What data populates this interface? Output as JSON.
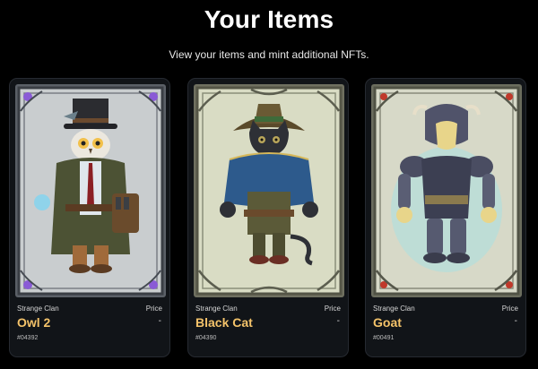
{
  "header": {
    "title": "Your Items",
    "subtitle": "View your items and mint additional NFTs."
  },
  "items": [
    {
      "clan": "Strange Clan",
      "name": "Owl 2",
      "price_label": "Price",
      "price": "-",
      "token": "#04392",
      "art": "owl-character-art",
      "frame_gem_color": "#8a5bd6"
    },
    {
      "clan": "Strange Clan",
      "name": "Black Cat",
      "price_label": "Price",
      "price": "-",
      "token": "#04390",
      "art": "black-cat-character-art",
      "frame_gem_color": "#8b8f7a"
    },
    {
      "clan": "Strange Clan",
      "name": "Goat",
      "price_label": "Price",
      "price": "-",
      "token": "#00491",
      "art": "goat-knight-character-art",
      "frame_gem_color": "#c0392b"
    }
  ],
  "colors": {
    "background": "#000000",
    "card_background": "#111418",
    "item_name": "#f4c36a"
  }
}
